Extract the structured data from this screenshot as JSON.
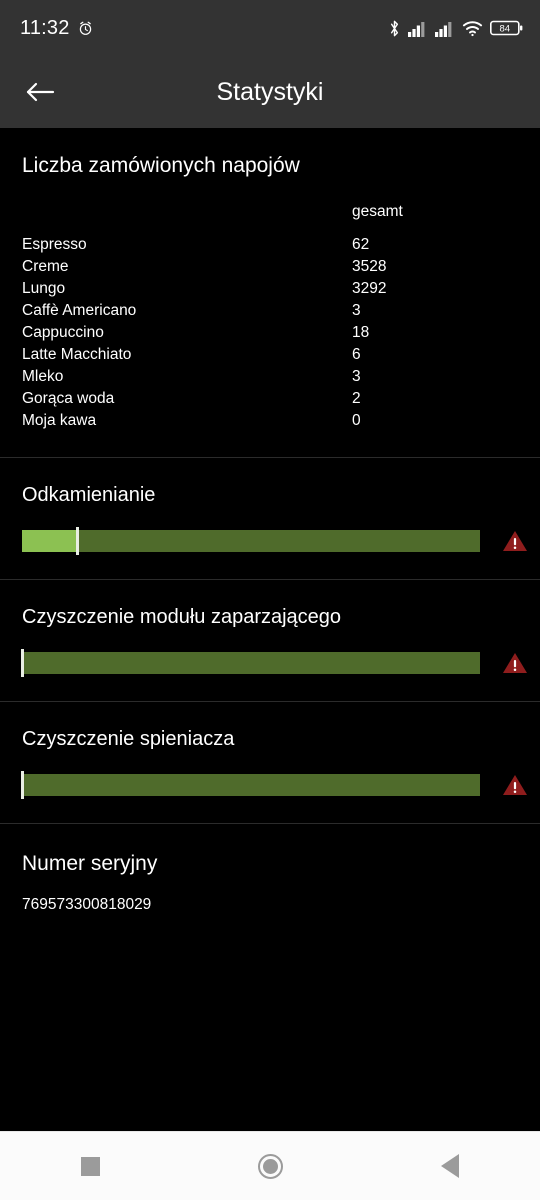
{
  "status_bar": {
    "time": "11:32",
    "alarm_icon": "alarm-clock-icon",
    "bluetooth_icon": "bluetooth-icon",
    "signal_icon_1": "cellular-signal-icon",
    "signal_icon_2": "cellular-signal-icon",
    "wifi_icon": "wifi-icon",
    "battery_level": "84",
    "battery_icon": "battery-icon"
  },
  "app_bar": {
    "back_icon": "back-arrow-icon",
    "title": "Statystyki"
  },
  "drinks": {
    "title": "Liczba zamówionych napojów",
    "columns": {
      "name": "",
      "total": "gesamt"
    },
    "rows": [
      {
        "name": "Espresso",
        "total": "62"
      },
      {
        "name": "Creme",
        "total": "3528"
      },
      {
        "name": "Lungo",
        "total": "3292"
      },
      {
        "name": "Caffè Americano",
        "total": "3"
      },
      {
        "name": "Cappuccino",
        "total": "18"
      },
      {
        "name": "Latte Macchiato",
        "total": "6"
      },
      {
        "name": "Mleko",
        "total": "3"
      },
      {
        "name": "Gorąca woda",
        "total": "2"
      },
      {
        "name": "Moja kawa",
        "total": "0"
      }
    ]
  },
  "maintenance": [
    {
      "title": "Odkamienianie",
      "fill_percent": 12,
      "marker_percent": 12,
      "warning_icon": "warning-triangle-icon"
    },
    {
      "title": "Czyszczenie modułu zaparzającego",
      "fill_percent": 0,
      "marker_percent": 0,
      "warning_icon": "warning-triangle-icon"
    },
    {
      "title": "Czyszczenie spieniacza",
      "fill_percent": 0,
      "marker_percent": 0,
      "warning_icon": "warning-triangle-icon"
    }
  ],
  "serial": {
    "title": "Numer seryjny",
    "value": "769573300818029"
  },
  "nav_bar": {
    "recents_icon": "square-recents-icon",
    "home_icon": "circle-home-icon",
    "back_icon": "triangle-back-icon"
  },
  "colors": {
    "bar_fill": "#8cc152",
    "bar_track": "#4f6b2b",
    "bar_marker": "#e9eee4",
    "warning": "#8f1d1d",
    "app_bar_bg": "#333333",
    "content_bg": "#000000"
  }
}
